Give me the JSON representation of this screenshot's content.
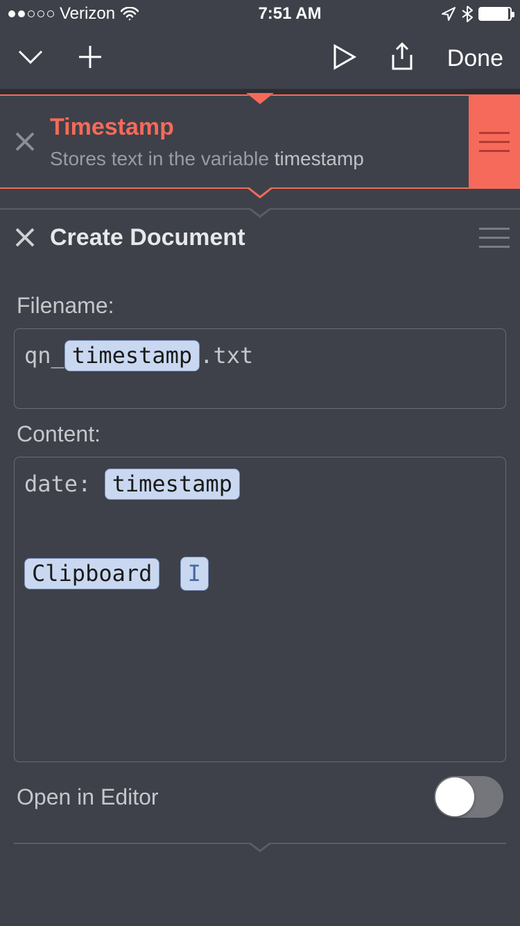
{
  "status": {
    "carrier": "Verizon",
    "time": "7:51 AM"
  },
  "toolbar": {
    "done": "Done"
  },
  "step1": {
    "title": "Timestamp",
    "subtitle_prefix": "Stores text in the variable ",
    "subtitle_var": "timestamp"
  },
  "step2": {
    "title": "Create Document"
  },
  "params": {
    "filename_label": "Filename:",
    "filename_prefix": "qn_",
    "filename_token": "timestamp",
    "filename_suffix": ".txt",
    "content_label": "Content:",
    "content_prefix": "date: ",
    "content_token1": "timestamp",
    "content_token2": "Clipboard",
    "cursor": "I",
    "open_editor": "Open in Editor",
    "toggle_on": false
  }
}
